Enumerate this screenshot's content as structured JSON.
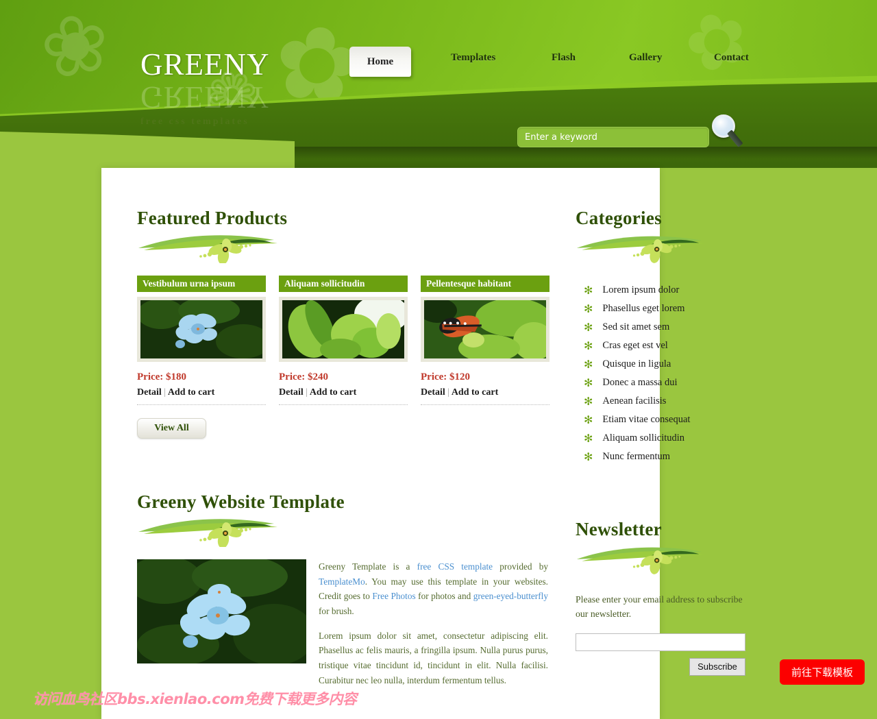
{
  "site": {
    "logo_main": "Greeny",
    "logo_reflection": "Greeny",
    "tagline": "free css templates"
  },
  "nav": {
    "items": [
      {
        "label": "Home",
        "active": true
      },
      {
        "label": "Templates",
        "active": false
      },
      {
        "label": "Flash",
        "active": false
      },
      {
        "label": "Gallery",
        "active": false
      },
      {
        "label": "Contact",
        "active": false
      }
    ]
  },
  "search": {
    "placeholder": "Enter a keyword",
    "value": "",
    "button_icon": "magnifier-icon"
  },
  "featured": {
    "heading": "Featured Products",
    "divider_icon": "floral-swoosh-divider",
    "products": [
      {
        "title": "Vestibulum urna ipsum",
        "price": "Price: $180",
        "detail_label": "Detail",
        "separator": "|",
        "cart_label": "Add to cart",
        "image_alt": "blue-plumbago-flowers-photo"
      },
      {
        "title": "Aliquam sollicitudin",
        "price": "Price: $240",
        "detail_label": "Detail",
        "separator": "|",
        "cart_label": "Add to cart",
        "image_alt": "green-leaves-photo"
      },
      {
        "title": "Pellentesque habitant",
        "price": "Price: $120",
        "detail_label": "Detail",
        "separator": "|",
        "cart_label": "Add to cart",
        "image_alt": "orange-butterfly-on-leaf-photo"
      }
    ],
    "view_all_label": "View All"
  },
  "about": {
    "heading": "Greeny Website Template",
    "divider_icon": "floral-swoosh-divider",
    "image_alt": "blue-plumbago-flowers-large-photo",
    "paragraph1": {
      "t1": "Greeny Template is a ",
      "link1": "free CSS template",
      "t2": " provided by ",
      "link2": "TemplateMo",
      "t3": ". You may use this template in your websites. Credit goes to ",
      "link3": "Free Photos",
      "t4": " for photos and ",
      "link4": "green-eyed-butterfly",
      "t5": " for brush."
    },
    "paragraph2": "Lorem ipsum dolor sit amet, consectetur adipiscing elit. Phasellus ac felis mauris, a fringilla ipsum. Nulla purus purus, tristique vitae tincidunt id, tincidunt in elit. Nulla facilisi. Curabitur nec leo nulla, interdum fermentum tellus."
  },
  "categories": {
    "heading": "Categories",
    "divider_icon": "floral-swoosh-divider",
    "bullet_icon": "green-asterisk-flower-bullet",
    "items": [
      "Lorem ipsum dolor",
      "Phasellus eget lorem",
      "Sed sit amet sem",
      "Cras eget est vel",
      "Quisque in ligula",
      "Donec a massa dui",
      "Aenean facilisis",
      "Etiam vitae consequat",
      "Aliquam sollicitudin",
      "Nunc fermentum"
    ]
  },
  "newsletter": {
    "heading": "Newsletter",
    "divider_icon": "floral-swoosh-divider",
    "text": "Please enter your email address to subscribe our newsletter.",
    "email_value": "",
    "submit_label": "Subscribe"
  },
  "overlays": {
    "watermark": "访问血鸟社区bbs.xienlao.com免费下载更多内容",
    "download_button": "前往下载模板"
  },
  "colors": {
    "header_green": "#76b418",
    "dark_green_band": "#426f0b",
    "page_green": "#9ac63f",
    "heading_green": "#2f5007",
    "price_red": "#c0392b",
    "link_blue": "#4a8fcf",
    "product_bar": "#6ba010",
    "watermark_pink": "#ff8fa8",
    "download_red": "#fc0000"
  }
}
